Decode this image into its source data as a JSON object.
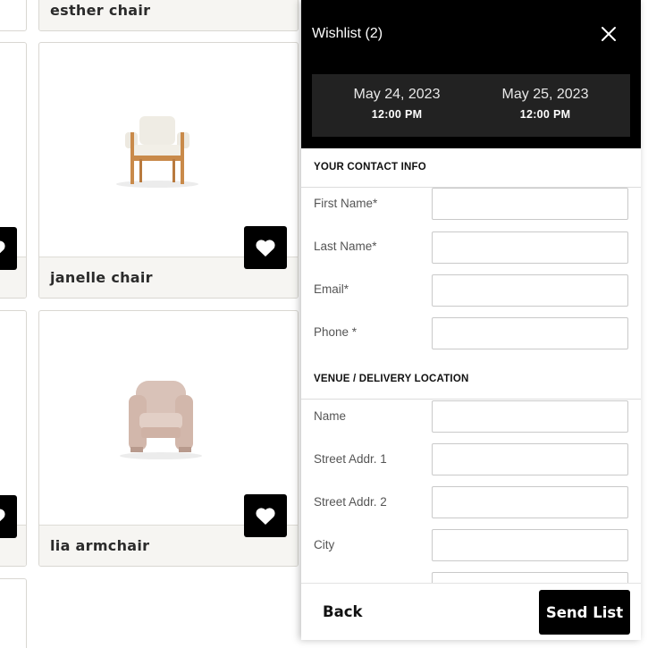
{
  "products": [
    {
      "name": "esther chair",
      "wishlisted": false
    },
    {
      "name": "janelle chair",
      "wishlisted": true
    },
    {
      "name": "lia armchair",
      "wishlisted": true
    }
  ],
  "drawer": {
    "title": "Wishlist (2)",
    "start": {
      "date": "May 24, 2023",
      "time": "12:00 PM"
    },
    "end": {
      "date": "May 25, 2023",
      "time": "12:00 PM"
    },
    "contact_section": "YOUR CONTACT INFO",
    "contact_fields": [
      {
        "label": "First Name*",
        "value": ""
      },
      {
        "label": "Last Name*",
        "value": ""
      },
      {
        "label": "Email*",
        "value": ""
      },
      {
        "label": "Phone *",
        "value": ""
      }
    ],
    "venue_section": "VENUE / DELIVERY LOCATION",
    "venue_fields": [
      {
        "label": "Name",
        "value": ""
      },
      {
        "label": "Street Addr. 1",
        "value": ""
      },
      {
        "label": "Street Addr. 2",
        "value": ""
      },
      {
        "label": "City",
        "value": ""
      }
    ],
    "back_label": "Back",
    "send_label": "Send List"
  },
  "colors": {
    "accent": "#000000",
    "label_bar": "#f6f5f2",
    "date_panel": "#222222"
  },
  "icons": {
    "close": "close-icon",
    "heart": "heart-icon"
  }
}
